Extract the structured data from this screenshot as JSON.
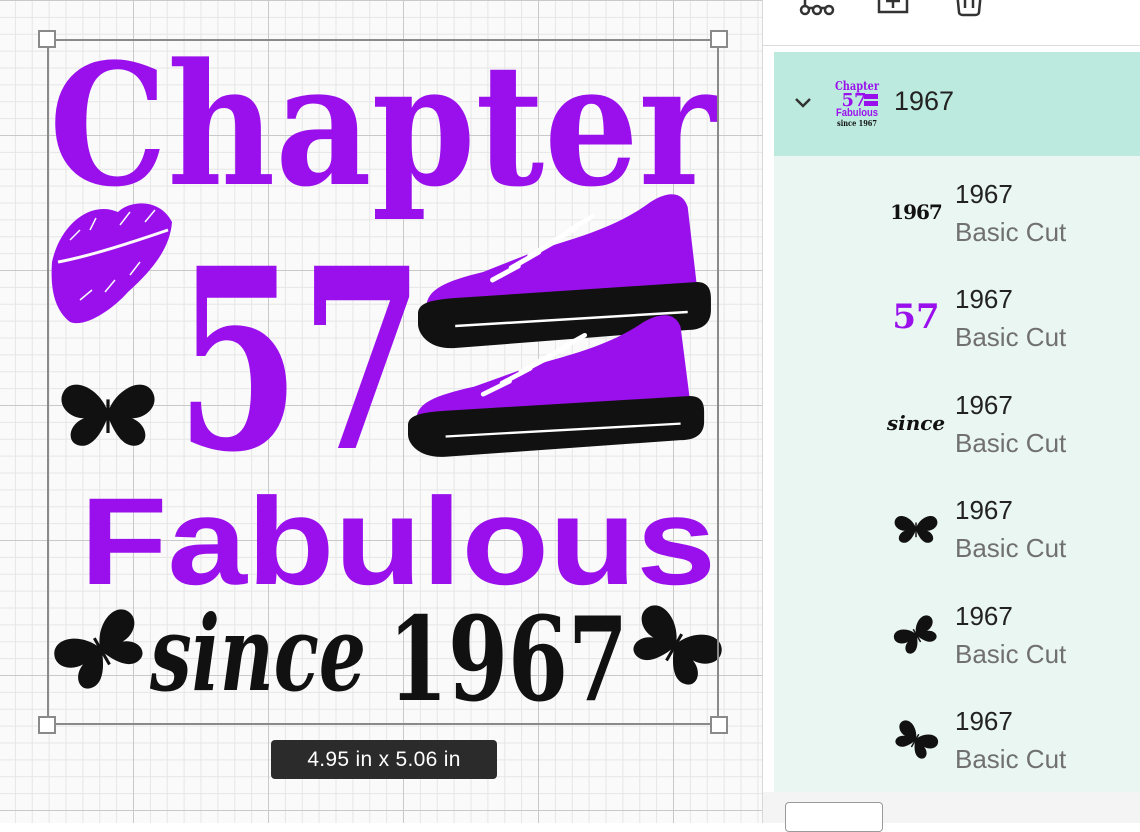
{
  "canvas": {
    "design": {
      "line1": "Chapter",
      "line2": "57",
      "line3": "Fabulous",
      "line4_script": "since",
      "line4_year": "1967"
    },
    "dimensions_label": "4.95  in x 5.06  in",
    "colors": {
      "purple": "#9a10ec",
      "black": "#111111",
      "grid": "#c9c9c9"
    }
  },
  "toolbar": {
    "icons": [
      "connect-icon",
      "add-layer-icon",
      "delete-icon"
    ]
  },
  "layers": {
    "group": {
      "name": "1967",
      "expanded": true,
      "thumb_icon": "design-thumbnail"
    },
    "items": [
      {
        "name": "1967",
        "operation": "Basic Cut",
        "thumb": "1967",
        "thumb_icon": "text-1967-thumbnail"
      },
      {
        "name": "1967",
        "operation": "Basic Cut",
        "thumb": "57",
        "thumb_icon": "text-57-thumbnail"
      },
      {
        "name": "1967",
        "operation": "Basic Cut",
        "thumb": "since",
        "thumb_icon": "text-since-thumbnail"
      },
      {
        "name": "1967",
        "operation": "Basic Cut",
        "thumb_icon": "butterfly-icon"
      },
      {
        "name": "1967",
        "operation": "Basic Cut",
        "thumb_icon": "butterfly-icon"
      },
      {
        "name": "1967",
        "operation": "Basic Cut",
        "thumb_icon": "butterfly-icon"
      }
    ],
    "colors": {
      "group_bg": "#bdeadf",
      "list_bg": "#eaf6f2"
    }
  }
}
